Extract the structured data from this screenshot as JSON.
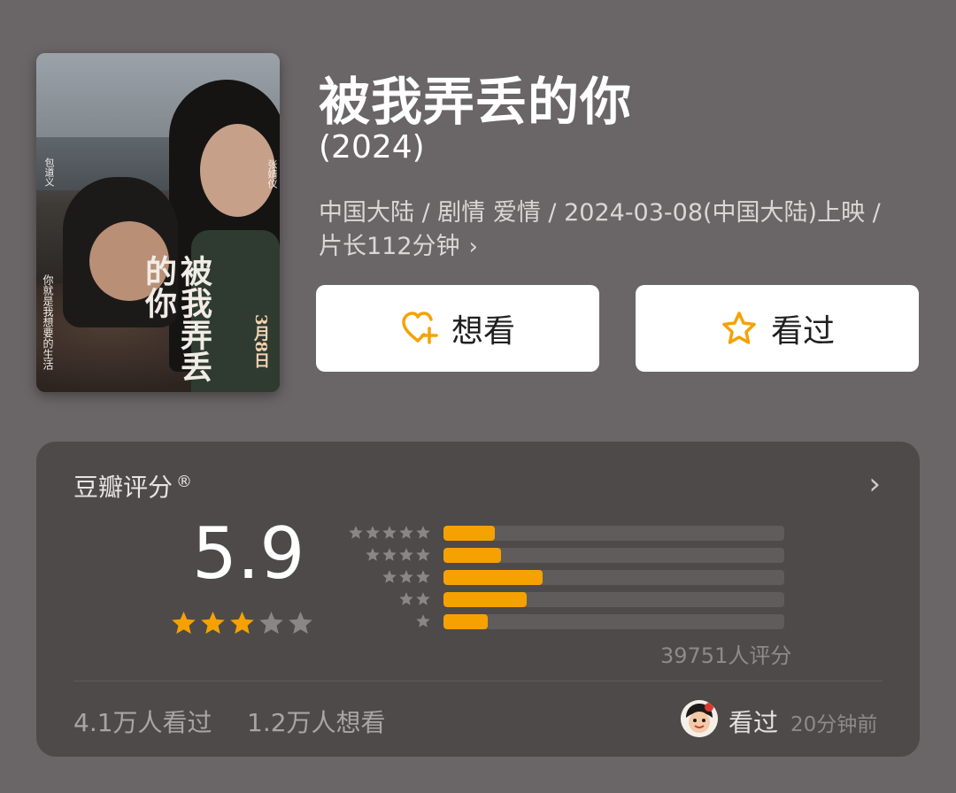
{
  "movie": {
    "title": "被我弄丢的你",
    "year": "(2024)",
    "meta": "中国大陆 / 剧情 爱情 / 2024-03-08(中国大陆)上映 / 片长112分钟",
    "meta_chevron": "›",
    "poster": {
      "title_text": "被我弄丢的你",
      "tagline": "你就是我想要的生活",
      "actor_left": "包道义",
      "actor_right": "张婧仪",
      "date_text": "3月8日"
    }
  },
  "actions": {
    "want_label": "想看",
    "seen_label": "看过",
    "accent": "#f5a200"
  },
  "rating": {
    "title": "豆瓣评分",
    "reg_mark": "®",
    "chevron": "›",
    "score": "5.9",
    "stars_filled": 3,
    "stars_total": 5,
    "distribution": [
      {
        "stars": 5,
        "fraction": 0.15
      },
      {
        "stars": 4,
        "fraction": 0.17
      },
      {
        "stars": 3,
        "fraction": 0.29
      },
      {
        "stars": 2,
        "fraction": 0.245
      },
      {
        "stars": 1,
        "fraction": 0.13
      }
    ],
    "count_text": "39751人评分"
  },
  "footer": {
    "seen_count": "4.1万人看过",
    "want_count": "1.2万人想看",
    "user_status": "看过",
    "user_time": "20分钟前"
  }
}
